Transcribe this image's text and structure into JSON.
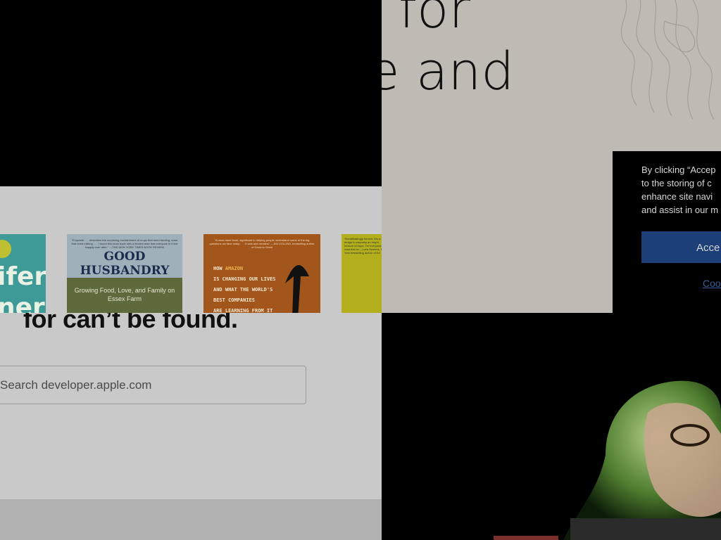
{
  "hero": {
    "headline_line1": "for",
    "headline_line2": "e and",
    "headline_line3": "."
  },
  "apple_404": {
    "heading": "for can’t be found.",
    "search": {
      "placeholder": "Search developer.apple.com"
    }
  },
  "books": [
    {
      "title_fragment": "ifer",
      "title_fragment2": "ner"
    },
    {
      "blurb": "\"Exquisite . . . describes the surprising enchantment of crops that need tending, cows that need milking . . . I found this book book with a fervent wish that everyone in it live happily ever after.\" —THE NEW YORK TIMES BOOK REVIEW",
      "title": "GOOD HUSBANDRY",
      "subtitle": "Growing Food, Love, and Family on Essex Farm"
    },
    {
      "blurb": "\"A must-have book, significant to helping people understand some of the big questions we face today . . . It was and remains\" —JIM COLLINS, bestselling author of Good to Great",
      "line1_pre": "HOW ",
      "line1_hl": "AMAZON",
      "line2": "IS CHANGING OUR LIVES",
      "line3": "AND WHAT THE WORLD'S",
      "line4": "BEST COMPANIES",
      "line5": "ARE LEARNING FROM IT"
    },
    {
      "blurb": "\"Breathtakingly honest. Wu a bridge to empathy an bright beacon of hope. I'm everyone to read this bo —Lara Sweerts, New York bestselling author of Ed"
    }
  ],
  "cookie": {
    "line1": "By clicking “Accep",
    "line2": "to the storing of c",
    "line3": "enhance site navi",
    "line4": "and assist in our m",
    "accept_label": "Acce",
    "settings_label": "Coo"
  },
  "colors": {
    "cookie_button": "#1b3f76",
    "book_teal": "#3e9a96",
    "book_orange": "#a3561c"
  }
}
